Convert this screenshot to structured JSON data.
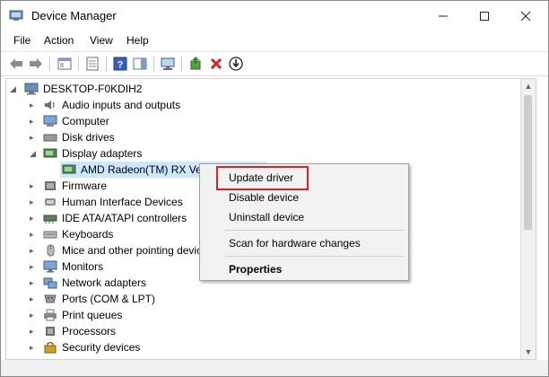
{
  "window": {
    "title": "Device Manager"
  },
  "menu": [
    "File",
    "Action",
    "View",
    "Help"
  ],
  "tree": {
    "root": "DESKTOP-F0KDIH2",
    "items": [
      "Audio inputs and outputs",
      "Computer",
      "Disk drives",
      "Display adapters",
      "AMD Radeon(TM) RX Vega 11 Graphics",
      "Firmware",
      "Human Interface Devices",
      "IDE ATA/ATAPI controllers",
      "Keyboards",
      "Mice and other pointing devices",
      "Monitors",
      "Network adapters",
      "Ports (COM & LPT)",
      "Print queues",
      "Processors",
      "Security devices"
    ]
  },
  "context_menu": {
    "items": [
      "Update driver",
      "Disable device",
      "Uninstall device",
      "Scan for hardware changes",
      "Properties"
    ]
  },
  "colors": {
    "selection": "#cce8ff",
    "highlight_box": "#e02020",
    "delete_icon": "#d81e1e"
  }
}
